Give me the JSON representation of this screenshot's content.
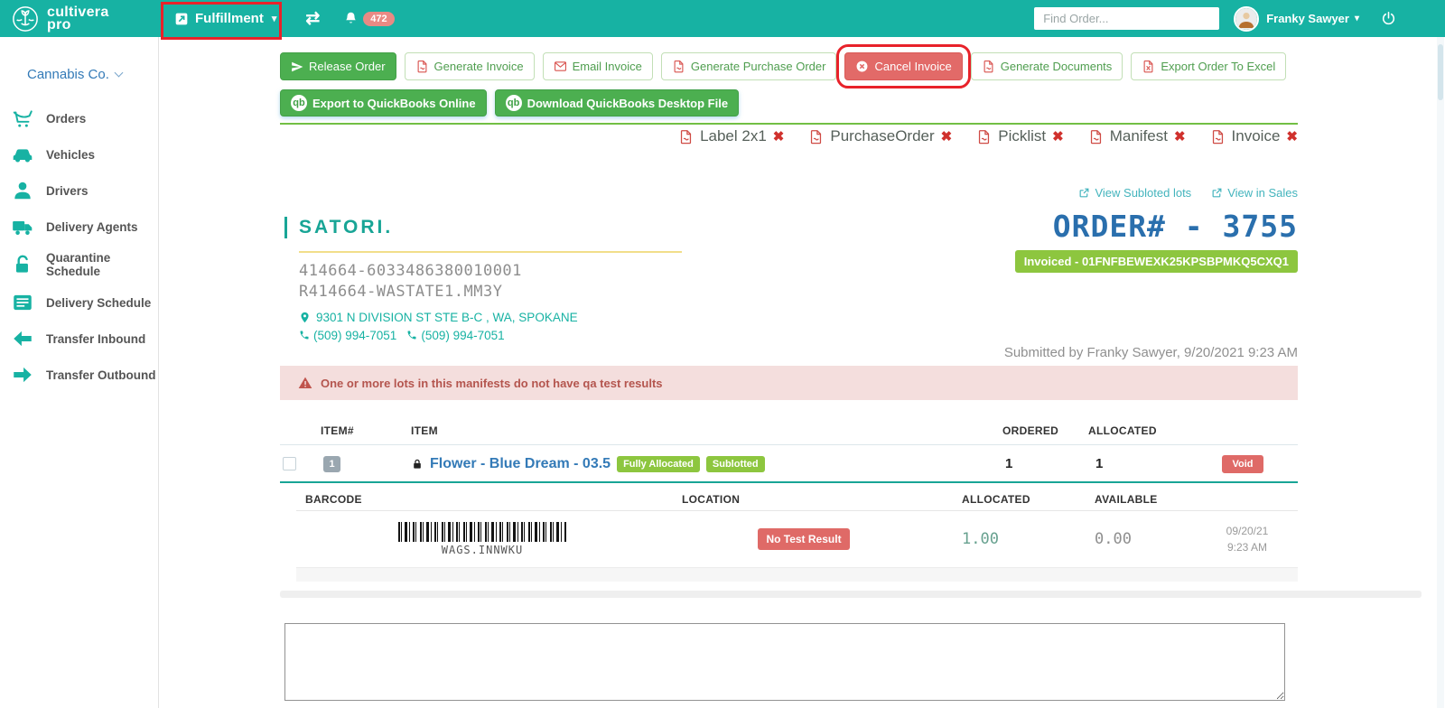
{
  "header": {
    "brand_line1": "cultivera",
    "brand_line2": "pro",
    "nav_current": "Fulfillment",
    "notification_count": "472",
    "search_placeholder": "Find Order...",
    "user_name": "Franky Sawyer"
  },
  "sidebar": {
    "company": "Cannabis Co.",
    "items": [
      {
        "label": "Orders",
        "icon": "cart-icon"
      },
      {
        "label": "Vehicles",
        "icon": "car-icon"
      },
      {
        "label": "Drivers",
        "icon": "driver-icon"
      },
      {
        "label": "Delivery Agents",
        "icon": "delivery-truck-icon"
      },
      {
        "label": "Quarantine Schedule",
        "icon": "unlock-icon"
      },
      {
        "label": "Delivery Schedule",
        "icon": "schedule-icon"
      },
      {
        "label": "Transfer Inbound",
        "icon": "arrow-left-icon"
      },
      {
        "label": "Transfer Outbound",
        "icon": "arrow-right-icon"
      }
    ]
  },
  "toolbar": {
    "row1": [
      {
        "label": "Release Order"
      },
      {
        "label": "Generate Invoice"
      },
      {
        "label": "Email Invoice"
      },
      {
        "label": "Generate Purchase Order"
      },
      {
        "label": "Cancel Invoice"
      },
      {
        "label": "Generate Documents"
      },
      {
        "label": "Export Order To Excel"
      }
    ],
    "row2": [
      {
        "label": "Export to QuickBooks Online"
      },
      {
        "label": "Download QuickBooks Desktop File"
      }
    ]
  },
  "documents": [
    "Label 2x1",
    "PurchaseOrder",
    "Picklist",
    "Manifest",
    "Invoice"
  ],
  "links": {
    "view_subloted": "View Subloted lots",
    "view_in_sales": "View in Sales"
  },
  "order": {
    "customer": "SATORI.",
    "license_line1": "414664-6033486380010001",
    "license_line2": "R414664-WASTATE1.MM3Y",
    "address": "9301 N DIVISION ST STE B-C , WA, SPOKANE",
    "phone1": "(509) 994-7051",
    "phone2": "(509) 994-7051",
    "order_number": "ORDER# - 3755",
    "invoice_status": "Invoiced - 01FNFBEWEXK25KPSBPMKQ5CXQ1",
    "submitted": "Submitted by Franky Sawyer, 9/20/2021 9:23 AM",
    "warning": "One or more lots in this manifests do not have qa test results"
  },
  "items_table": {
    "headers": {
      "item_no": "ITEM#",
      "item": "ITEM",
      "ordered": "ORDERED",
      "allocated": "ALLOCATED"
    },
    "row": {
      "index": "1",
      "name": "Flower - Blue Dream - 03.5",
      "badges": [
        "Fully Allocated",
        "Sublotted"
      ],
      "ordered": "1",
      "allocated": "1",
      "action": "Void"
    }
  },
  "lots_table": {
    "headers": {
      "barcode": "BARCODE",
      "location": "LOCATION",
      "allocated": "ALLOCATED",
      "available": "AVAILABLE"
    },
    "row": {
      "barcode_label": "WAGS.INNWKU",
      "test_badge": "No Test Result",
      "allocated": "1.00",
      "available": "0.00",
      "date": "09/20/21",
      "time": "9:23 AM"
    }
  },
  "icons": {
    "caret": "▾",
    "swap": "⇄",
    "x_mark": "✖",
    "qb": "qb"
  },
  "colors": {
    "teal": "#17b2a3",
    "green": "#4caf50",
    "badge_green": "#8dc63f",
    "salmon_red": "#df6a67",
    "annotation_red": "#e8222a",
    "link_blue": "#337ab7",
    "order_blue": "#2a6fad",
    "warning_bg": "#f4dedd"
  }
}
